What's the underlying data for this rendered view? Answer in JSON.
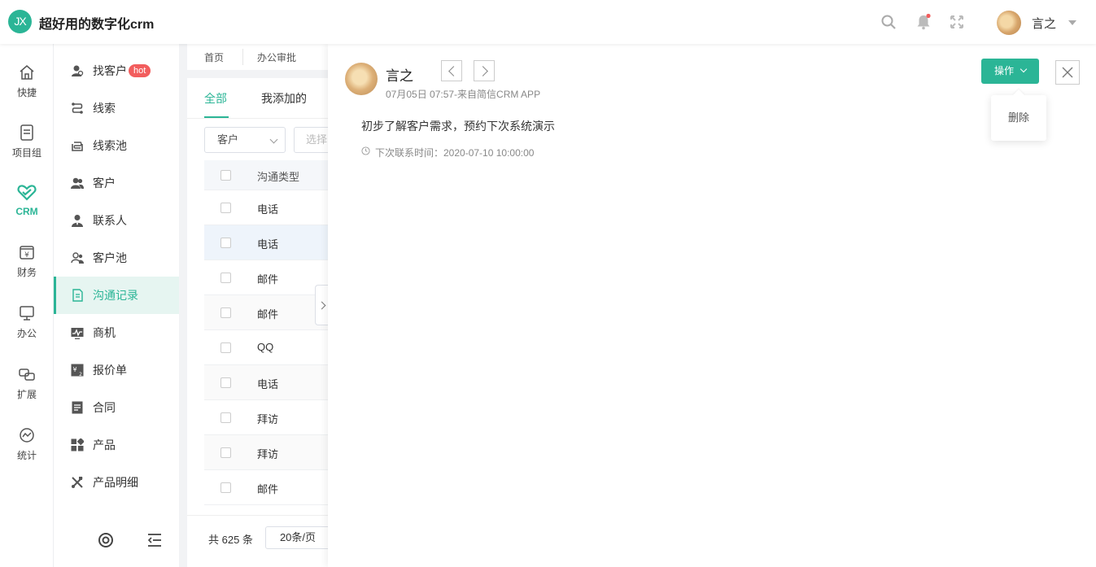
{
  "app": {
    "logo_text": "JX",
    "title": "超好用的数字化crm",
    "user_name": "言之"
  },
  "colors": {
    "accent": "#2bb596",
    "hot": "#f25d5d"
  },
  "topbar_icons": [
    "search-icon",
    "bell-icon",
    "fullscreen-icon"
  ],
  "nav_primary": [
    {
      "label": "快捷",
      "icon": "home-icon",
      "active": false
    },
    {
      "label": "项目组",
      "icon": "document-icon",
      "active": false
    },
    {
      "label": "CRM",
      "icon": "crm-icon",
      "active": true
    },
    {
      "label": "财务",
      "icon": "finance-icon",
      "active": false
    },
    {
      "label": "办公",
      "icon": "monitor-icon",
      "active": false
    },
    {
      "label": "扩展",
      "icon": "extend-icon",
      "active": false
    },
    {
      "label": "统计",
      "icon": "chart-icon",
      "active": false
    }
  ],
  "nav_secondary": [
    {
      "label": "找客户",
      "badge": "hot",
      "icon": "find-customer-icon"
    },
    {
      "label": "线索",
      "icon": "lead-icon"
    },
    {
      "label": "线索池",
      "icon": "lead-pool-icon"
    },
    {
      "label": "客户",
      "icon": "customer-icon"
    },
    {
      "label": "联系人",
      "icon": "contact-icon"
    },
    {
      "label": "客户池",
      "icon": "customer-pool-icon"
    },
    {
      "label": "沟通记录",
      "icon": "communication-icon",
      "active": true
    },
    {
      "label": "商机",
      "icon": "opportunity-icon"
    },
    {
      "label": "报价单",
      "icon": "quote-icon"
    },
    {
      "label": "合同",
      "icon": "contract-icon"
    },
    {
      "label": "产品",
      "icon": "product-icon"
    },
    {
      "label": "产品明细",
      "icon": "product-detail-icon"
    }
  ],
  "breadcrumbs": [
    "首页",
    "办公审批"
  ],
  "list": {
    "tabs": [
      "全部",
      "我添加的"
    ],
    "filter_select": "客户",
    "filter_placeholder": "选择",
    "column_header": "沟通类型",
    "rows": [
      "电话",
      "电话",
      "邮件",
      "邮件",
      "QQ",
      "电话",
      "拜访",
      "拜访",
      "邮件"
    ],
    "total": "共 625 条",
    "page_size": "20条/页"
  },
  "detail": {
    "author": "言之",
    "meta": "07月05日 07:57-来自简信CRM APP",
    "content": "初步了解客户需求，预约下次系统演示",
    "next_contact": "下次联系时间：2020-07-10 10:00:00",
    "action_label": "操作",
    "menu_delete": "删除"
  }
}
